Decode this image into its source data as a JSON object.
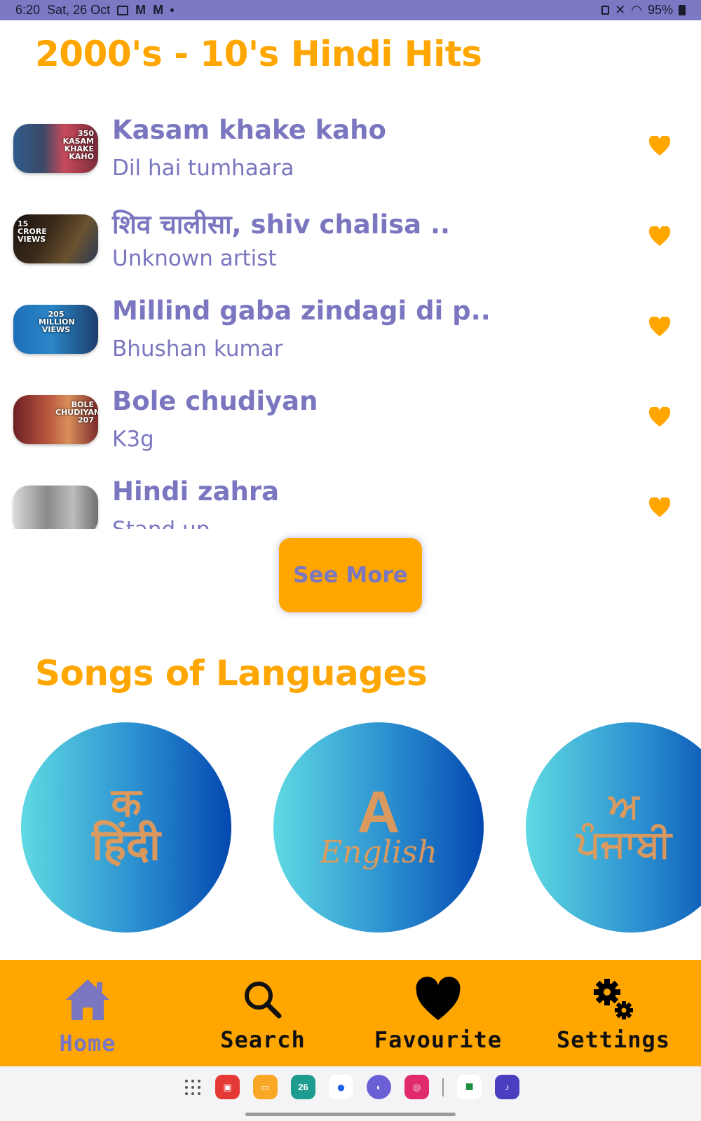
{
  "status_bar": {
    "time": "6:20",
    "date": "Sat, 26 Oct",
    "battery": "95%"
  },
  "hits_section": {
    "title": "2000's - 10's Hindi Hits"
  },
  "songs": [
    {
      "title": "Kasam khake kaho",
      "artist": "Dil hai tumhaara",
      "thumb_text": "350 KASAM KHAKE KAHO"
    },
    {
      "title": "शिव चालीसा, shiv chalisa ..",
      "artist": "Unknown artist",
      "thumb_text": "15 CRORE VIEWS"
    },
    {
      "title": "Millind gaba zindagi di p..",
      "artist": "Bhushan kumar",
      "thumb_text": "205 MILLION VIEWS"
    },
    {
      "title": "Bole chudiyan",
      "artist": "K3g",
      "thumb_text": "BOLE CHUDIYAN 207"
    },
    {
      "title": "Hindi zahra",
      "artist": "Stand up",
      "thumb_text": ""
    }
  ],
  "see_more_label": "See More",
  "languages_section": {
    "title": "Songs of Languages",
    "items": [
      {
        "glyph": "हिंदी",
        "mark": "क"
      },
      {
        "glyph": "English",
        "mark": "A"
      },
      {
        "glyph": "ਪੰਜਾਬੀ",
        "mark": "ਅ"
      }
    ]
  },
  "bottom_nav": {
    "home": "Home",
    "search": "Search",
    "favourite": "Favourite",
    "settings": "Settings"
  },
  "colors": {
    "accent": "#ffa600",
    "primary": "#7a77c0",
    "status_bar": "#7b79c4"
  },
  "dock": {
    "calendar_day": "26"
  }
}
